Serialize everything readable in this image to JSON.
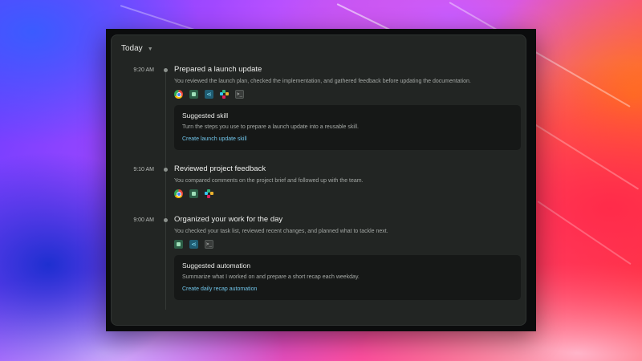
{
  "header": {
    "title": "Today",
    "chevron_icon": "chevron-down-icon"
  },
  "entries": [
    {
      "time": "9:20 AM",
      "title": "Prepared a launch update",
      "description": "You reviewed the launch plan, checked the implementation, and gathered feedback before updating the documentation.",
      "apps": [
        "chrome-icon",
        "docs-icon",
        "share-icon",
        "slack-icon",
        "terminal-icon"
      ],
      "suggestion": {
        "title": "Suggested skill",
        "description": "Turn the steps you use to prepare a launch update into a reusable skill.",
        "link": "Create launch update skill"
      }
    },
    {
      "time": "9:10 AM",
      "title": "Reviewed project feedback",
      "description": "You compared comments on the project brief and followed up with the team.",
      "apps": [
        "chrome-icon",
        "docs-icon",
        "slack-icon"
      ]
    },
    {
      "time": "9:00 AM",
      "title": "Organized your work for the day",
      "description": "You checked your task list, reviewed recent changes, and planned what to tackle next.",
      "apps": [
        "docs-icon",
        "share-icon",
        "terminal-icon"
      ],
      "suggestion": {
        "title": "Suggested automation",
        "description": "Summarize what I worked on and prepare a short recap each weekday.",
        "link": "Create daily recap automation"
      }
    }
  ],
  "colors": {
    "panel": "#222523",
    "card": "#161817",
    "link": "#6fc3e8",
    "text_primary": "#ecedeb",
    "text_secondary": "#a3a7a4"
  }
}
